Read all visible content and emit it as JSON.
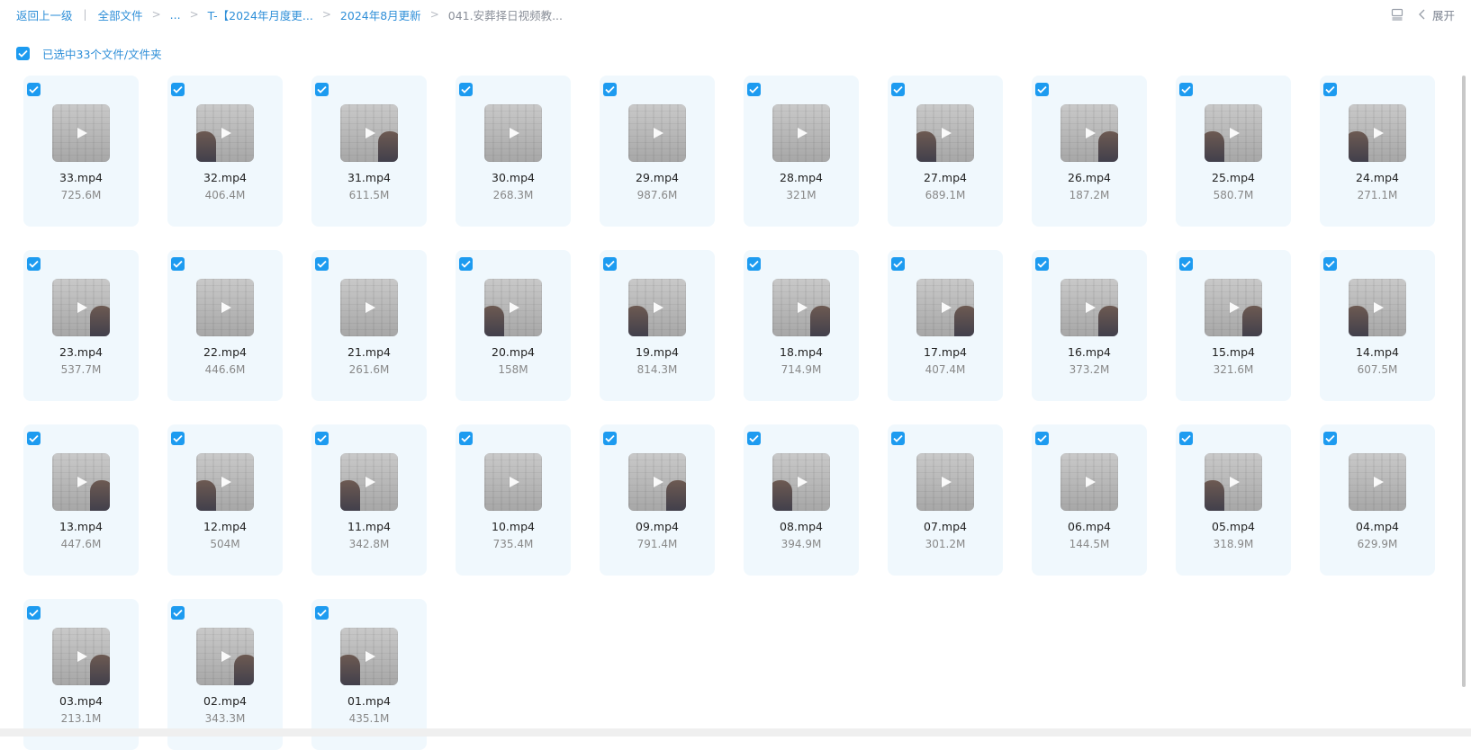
{
  "breadcrumb": {
    "back": "返回上一级",
    "root": "全部文件",
    "ellipsis": "...",
    "items": [
      "T-【2024年月度更...",
      "2024年8月更新"
    ],
    "current": "041.安葬择日视频教..."
  },
  "toolbar": {
    "expand_label": "展开"
  },
  "selection": {
    "label": "已选中33个文件/文件夹"
  },
  "files": [
    {
      "name": "33.mp4",
      "size": "725.6M"
    },
    {
      "name": "32.mp4",
      "size": "406.4M"
    },
    {
      "name": "31.mp4",
      "size": "611.5M"
    },
    {
      "name": "30.mp4",
      "size": "268.3M"
    },
    {
      "name": "29.mp4",
      "size": "987.6M"
    },
    {
      "name": "28.mp4",
      "size": "321M"
    },
    {
      "name": "27.mp4",
      "size": "689.1M"
    },
    {
      "name": "26.mp4",
      "size": "187.2M"
    },
    {
      "name": "25.mp4",
      "size": "580.7M"
    },
    {
      "name": "24.mp4",
      "size": "271.1M"
    },
    {
      "name": "23.mp4",
      "size": "537.7M"
    },
    {
      "name": "22.mp4",
      "size": "446.6M"
    },
    {
      "name": "21.mp4",
      "size": "261.6M"
    },
    {
      "name": "20.mp4",
      "size": "158M"
    },
    {
      "name": "19.mp4",
      "size": "814.3M"
    },
    {
      "name": "18.mp4",
      "size": "714.9M"
    },
    {
      "name": "17.mp4",
      "size": "407.4M"
    },
    {
      "name": "16.mp4",
      "size": "373.2M"
    },
    {
      "name": "15.mp4",
      "size": "321.6M"
    },
    {
      "name": "14.mp4",
      "size": "607.5M"
    },
    {
      "name": "13.mp4",
      "size": "447.6M"
    },
    {
      "name": "12.mp4",
      "size": "504M"
    },
    {
      "name": "11.mp4",
      "size": "342.8M"
    },
    {
      "name": "10.mp4",
      "size": "735.4M"
    },
    {
      "name": "09.mp4",
      "size": "791.4M"
    },
    {
      "name": "08.mp4",
      "size": "394.9M"
    },
    {
      "name": "07.mp4",
      "size": "301.2M"
    },
    {
      "name": "06.mp4",
      "size": "144.5M"
    },
    {
      "name": "05.mp4",
      "size": "318.9M"
    },
    {
      "name": "04.mp4",
      "size": "629.9M"
    },
    {
      "name": "03.mp4",
      "size": "213.1M"
    },
    {
      "name": "02.mp4",
      "size": "343.3M"
    },
    {
      "name": "01.mp4",
      "size": "435.1M"
    }
  ],
  "colors": {
    "accent": "#1d9bf0",
    "link": "#2f8fd8",
    "card_bg": "#f0f8fd"
  }
}
